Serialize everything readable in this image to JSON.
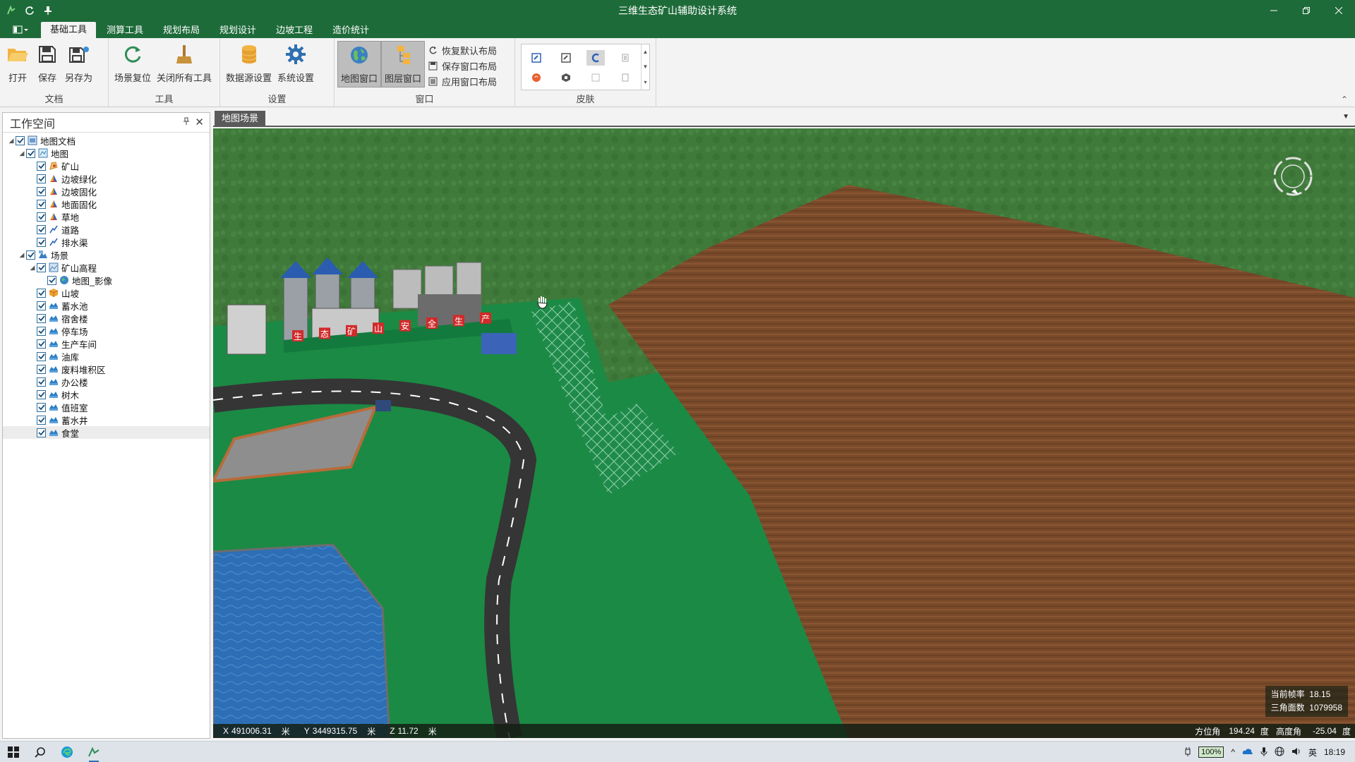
{
  "title_bar": {
    "title": "三维生态矿山辅助设计系统",
    "qat_icons": [
      "app-icon",
      "refresh-icon",
      "pin-icon"
    ],
    "window_controls": [
      "minimize-icon",
      "restore-icon",
      "close-icon"
    ]
  },
  "ribbon": {
    "tabs": [
      {
        "label": "基础工具",
        "active": true
      },
      {
        "label": "测算工具",
        "active": false
      },
      {
        "label": "规划布局",
        "active": false
      },
      {
        "label": "规划设计",
        "active": false
      },
      {
        "label": "边坡工程",
        "active": false
      },
      {
        "label": "造价统计",
        "active": false
      }
    ],
    "groups": {
      "document": {
        "label": "文档",
        "open": "打开",
        "save": "保存",
        "save_as": "另存为"
      },
      "tools": {
        "label": "工具",
        "reset_scene": "场景复位",
        "close_all": "关闭所有工具"
      },
      "settings": {
        "label": "设置",
        "datasource": "数据源设置",
        "system": "系统设置"
      },
      "window": {
        "label": "窗口",
        "map_window": "地图窗口",
        "layer_window": "图层窗口",
        "restore_layout": "恢复默认布局",
        "save_layout": "保存窗口布局",
        "apply_layout": "应用窗口布局"
      },
      "skin": {
        "label": "皮肤"
      }
    }
  },
  "workspace": {
    "title": "工作空间",
    "tree": [
      {
        "label": "地图文档",
        "level": 0,
        "expand": "open",
        "icon": "document-icon"
      },
      {
        "label": "地图",
        "level": 1,
        "expand": "open",
        "icon": "map-icon"
      },
      {
        "label": "矿山",
        "level": 2,
        "icon": "region-layer-icon"
      },
      {
        "label": "边坡绿化",
        "level": 2,
        "icon": "polygon-layer-icon"
      },
      {
        "label": "边坡固化",
        "level": 2,
        "icon": "polygon-layer-icon"
      },
      {
        "label": "地面固化",
        "level": 2,
        "icon": "polygon-layer-icon"
      },
      {
        "label": "草地",
        "level": 2,
        "icon": "polygon-layer-icon"
      },
      {
        "label": "道路",
        "level": 2,
        "icon": "line-layer-icon"
      },
      {
        "label": "排水渠",
        "level": 2,
        "icon": "line-layer-icon"
      },
      {
        "label": "场景",
        "level": 1,
        "expand": "open",
        "icon": "scene-icon"
      },
      {
        "label": "矿山高程",
        "level": 2,
        "expand": "open",
        "icon": "terrain-icon"
      },
      {
        "label": "地图_影像",
        "level": 3,
        "icon": "image-layer-icon"
      },
      {
        "label": "山坡",
        "level": 2,
        "icon": "model-layer-icon"
      },
      {
        "label": "蓄水池",
        "level": 2,
        "icon": "kml-layer-icon"
      },
      {
        "label": "宿舍楼",
        "level": 2,
        "icon": "kml-layer-icon"
      },
      {
        "label": "停车场",
        "level": 2,
        "icon": "kml-layer-icon"
      },
      {
        "label": "生产车间",
        "level": 2,
        "icon": "kml-layer-icon"
      },
      {
        "label": "油库",
        "level": 2,
        "icon": "kml-layer-icon"
      },
      {
        "label": "废料堆积区",
        "level": 2,
        "icon": "kml-layer-icon"
      },
      {
        "label": "办公楼",
        "level": 2,
        "icon": "kml-layer-icon"
      },
      {
        "label": "树木",
        "level": 2,
        "icon": "kml-layer-icon"
      },
      {
        "label": "值班室",
        "level": 2,
        "icon": "kml-layer-icon"
      },
      {
        "label": "蓄水井",
        "level": 2,
        "icon": "kml-layer-icon"
      },
      {
        "label": "食堂",
        "level": 2,
        "icon": "kml-layer-icon",
        "highlight": true
      }
    ]
  },
  "scene": {
    "tab_label": "地图场景",
    "banner_chars": [
      "生",
      "态",
      "矿",
      "山",
      "安",
      "全",
      "生",
      "产"
    ],
    "status": {
      "x_label": "X",
      "x_value": "491006.31",
      "x_unit": "米",
      "y_label": "Y",
      "y_value": "3449315.75",
      "y_unit": "米",
      "z_label": "Z",
      "z_value": "11.72",
      "z_unit": "米",
      "azimuth_label": "方位角",
      "azimuth_value": "194.24",
      "azimuth_unit": "度",
      "elevation_label": "高度角",
      "elevation_value": "-25.04",
      "elevation_unit": "度"
    },
    "stats": {
      "fps_label": "当前帧率",
      "fps_value": "18.15",
      "tri_label": "三角面数",
      "tri_value": "1079958"
    }
  },
  "taskbar": {
    "icons": [
      "windows-start-icon",
      "search-icon",
      "edge-browser-icon",
      "app-taskbar-icon"
    ],
    "battery": "100%",
    "ime": "英",
    "time": "18:19"
  }
}
